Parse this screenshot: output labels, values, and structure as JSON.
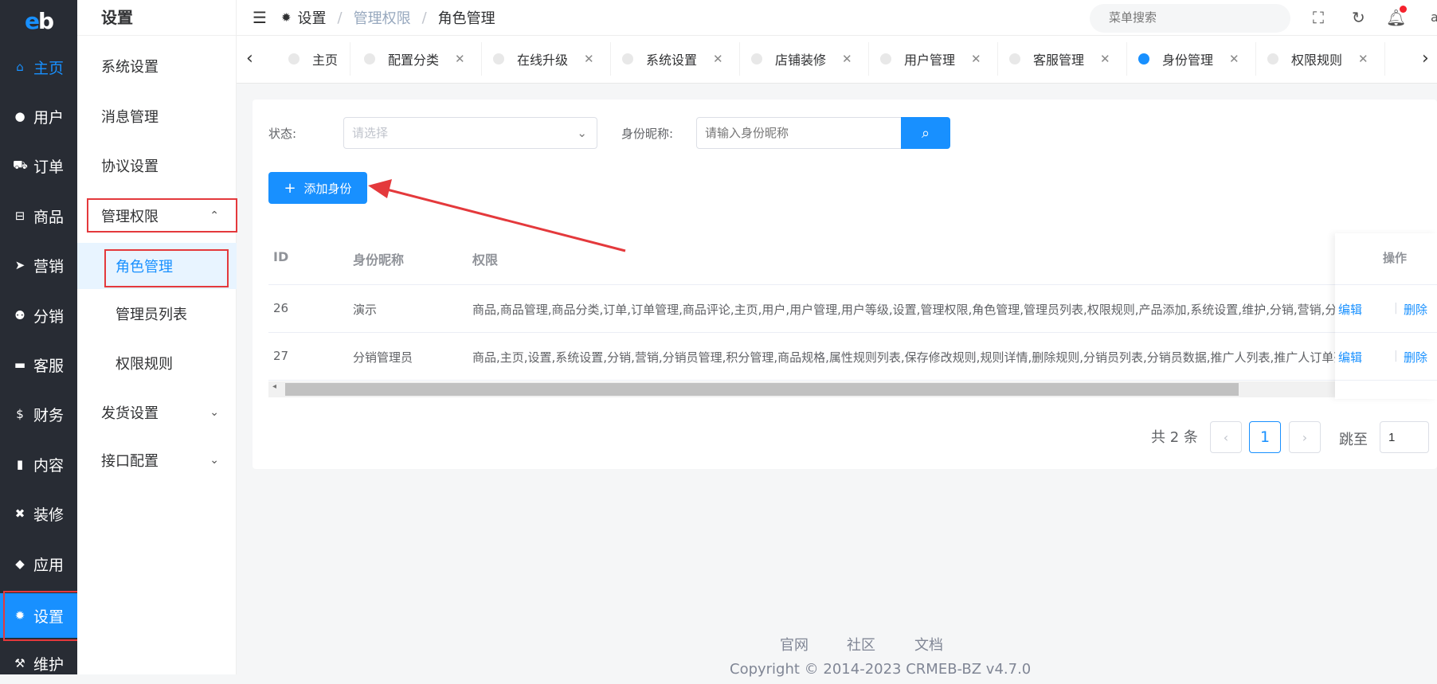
{
  "sidebar": {
    "logo": {
      "part1": "e",
      "part2": "b"
    },
    "items": [
      {
        "label": "主页",
        "icon": "home-icon"
      },
      {
        "label": "用户",
        "icon": "user-icon"
      },
      {
        "label": "订单",
        "icon": "cart-icon"
      },
      {
        "label": "商品",
        "icon": "basket-icon"
      },
      {
        "label": "营销",
        "icon": "send-icon"
      },
      {
        "label": "分销",
        "icon": "group-icon"
      },
      {
        "label": "客服",
        "icon": "chat-icon"
      },
      {
        "label": "财务",
        "icon": "dollar-icon"
      },
      {
        "label": "内容",
        "icon": "book-icon"
      },
      {
        "label": "装修",
        "icon": "tools-icon"
      },
      {
        "label": "应用",
        "icon": "cube-icon"
      },
      {
        "label": "设置",
        "icon": "gear-icon"
      },
      {
        "label": "维护",
        "icon": "hammer-icon"
      }
    ]
  },
  "submenu": {
    "title": "设置",
    "items": {
      "system": "系统设置",
      "message": "消息管理",
      "agreement": "协议设置",
      "permission": "管理权限",
      "role": "角色管理",
      "admin_list": "管理员列表",
      "rules": "权限规则",
      "shipping": "发货设置",
      "api": "接口配置"
    }
  },
  "header": {
    "breadcrumb": {
      "root": "设置",
      "sep": "/",
      "mid": "管理权限",
      "current": "角色管理"
    },
    "search_placeholder": "菜单搜索",
    "user_initial": "a"
  },
  "tabs": [
    {
      "label": "主页",
      "closable": false,
      "active": false
    },
    {
      "label": "配置分类",
      "closable": true,
      "active": false
    },
    {
      "label": "在线升级",
      "closable": true,
      "active": false
    },
    {
      "label": "系统设置",
      "closable": true,
      "active": false
    },
    {
      "label": "店铺装修",
      "closable": true,
      "active": false
    },
    {
      "label": "用户管理",
      "closable": true,
      "active": false
    },
    {
      "label": "客服管理",
      "closable": true,
      "active": false
    },
    {
      "label": "身份管理",
      "closable": true,
      "active": true
    },
    {
      "label": "权限规则",
      "closable": true,
      "active": false
    }
  ],
  "filters": {
    "status_label": "状态:",
    "status_placeholder": "请选择",
    "name_label": "身份昵称:",
    "name_placeholder": "请输入身份昵称"
  },
  "add_button": "添加身份",
  "table": {
    "headers": {
      "id": "ID",
      "name": "身份昵称",
      "perm": "权限",
      "ops": "操作"
    },
    "rows": [
      {
        "id": "26",
        "name": "演示",
        "perm": "商品,商品管理,商品分类,订单,订单管理,商品评论,主页,用户,用户管理,用户等级,设置,管理权限,角色管理,管理员列表,权限规则,产品添加,系统设置,维护,分销,营销,分销"
      },
      {
        "id": "27",
        "name": "分销管理员",
        "perm": "商品,主页,设置,系统设置,分销,营销,分销员管理,积分管理,商品规格,属性规则列表,保存修改规则,规则详情,删除规则,分销员列表,分销员数据,推广人列表,推广人订单列"
      }
    ],
    "edit": "编辑",
    "del": "删除",
    "pipe": "|"
  },
  "pagination": {
    "total": "共 2 条",
    "current": "1",
    "jump_label": "跳至",
    "jump_value": "1"
  },
  "footer": {
    "links": [
      "官网",
      "社区",
      "文档"
    ],
    "copyright": "Copyright © 2014-2023 CRMEB-BZ v4.7.0"
  },
  "colors": {
    "accent": "#1890ff",
    "sidebar": "#282c34",
    "highlight": "#e4393c"
  }
}
